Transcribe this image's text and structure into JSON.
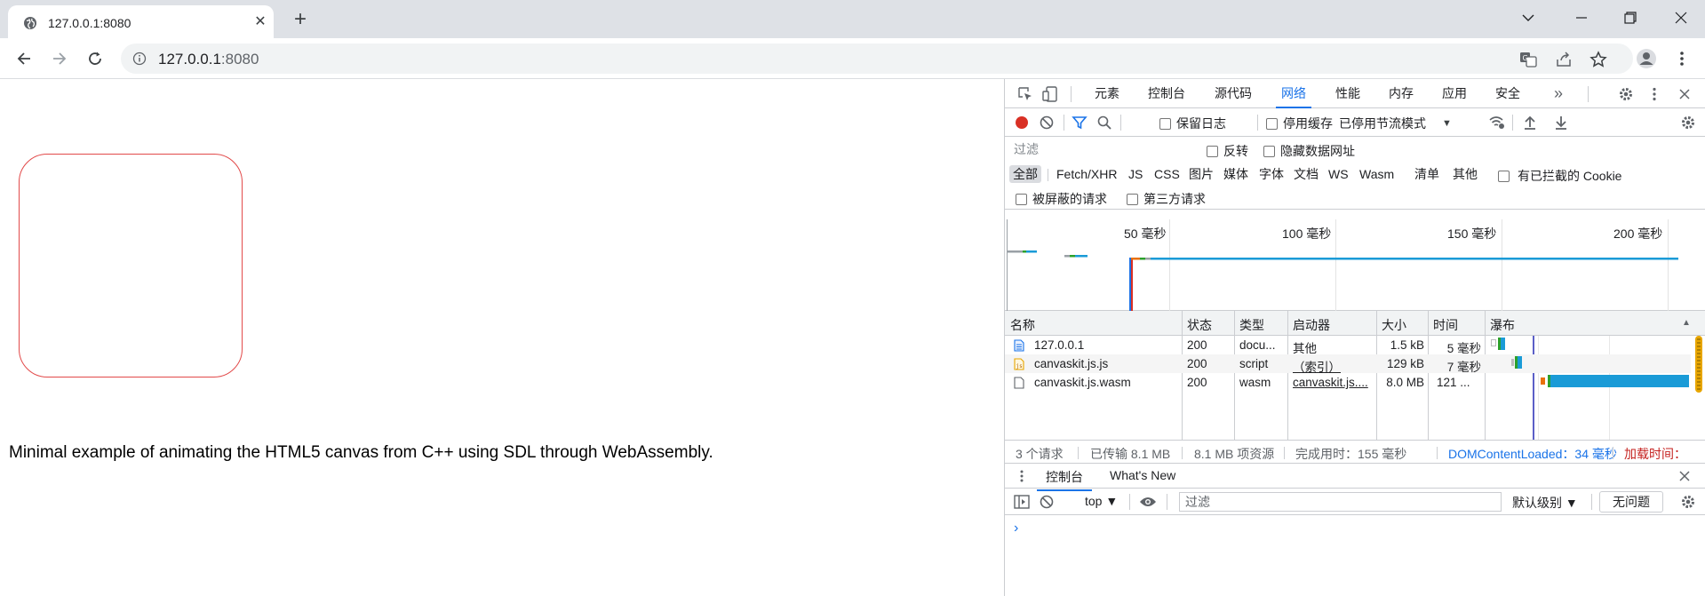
{
  "browser": {
    "tab_title": "127.0.0.1:8080",
    "url_host": "127.0.0.1",
    "url_port": ":8080",
    "tab_close": "✕",
    "new_tab": "+"
  },
  "page": {
    "text": "Minimal example of animating the HTML5 canvas from C++ using SDL through WebAssembly.",
    "canvas_border_color": "#e24a4a"
  },
  "devtools": {
    "tabs": [
      "元素",
      "控制台",
      "源代码",
      "网络",
      "性能",
      "内存",
      "应用",
      "安全"
    ],
    "active_tab": "网络",
    "more_tabs": "»",
    "toolbar": {
      "preserve_log": "保留日志",
      "disable_cache": "停用缓存",
      "throttle": "已停用节流模式"
    },
    "filter": {
      "placeholder": "过滤",
      "invert": "反转",
      "hide_data_urls": "隐藏数据网址"
    },
    "types": [
      "全部",
      "Fetch/XHR",
      "JS",
      "CSS",
      "图片",
      "媒体",
      "字体",
      "文档",
      "WS",
      "Wasm",
      "清单",
      "其他"
    ],
    "blocked_cookies": "有已拦截的 Cookie",
    "blocked_requests": "被屏蔽的请求",
    "third_party": "第三方请求",
    "overview_labels": [
      "50 毫秒",
      "100 毫秒",
      "150 毫秒",
      "200 毫秒"
    ],
    "columns": [
      "名称",
      "状态",
      "类型",
      "启动器",
      "大小",
      "时间",
      "瀑布"
    ],
    "rows": [
      {
        "name": "127.0.0.1",
        "status": "200",
        "type": "docu...",
        "initiator": "其他",
        "size": "1.5 kB",
        "time": "5 毫秒"
      },
      {
        "name": "canvaskit.js.js",
        "status": "200",
        "type": "script",
        "initiator": "（索引）",
        "size": "129 kB",
        "time": "7 毫秒"
      },
      {
        "name": "canvaskit.js.wasm",
        "status": "200",
        "type": "wasm",
        "initiator": "canvaskit.js....",
        "size": "8.0 MB",
        "time": "121 ..."
      }
    ],
    "summary": {
      "requests": "3 个请求",
      "transferred": "已传输 8.1 MB",
      "resources": "8.1 MB 项资源",
      "finish": "完成用时：155 毫秒",
      "dcl": "DOMContentLoaded：34 毫秒",
      "load": "加载时间："
    },
    "drawer": {
      "console_tab": "控制台",
      "whats_new": "What's New",
      "context": "top ▼",
      "filter_placeholder": "过滤",
      "levels": "默认级别 ▼",
      "issues": "无问题",
      "prompt": "›"
    },
    "colors": {
      "accent": "#1a73e8",
      "record": "#d93025",
      "waterfall": "#1a9bd7",
      "queue": "#e8710a"
    }
  }
}
